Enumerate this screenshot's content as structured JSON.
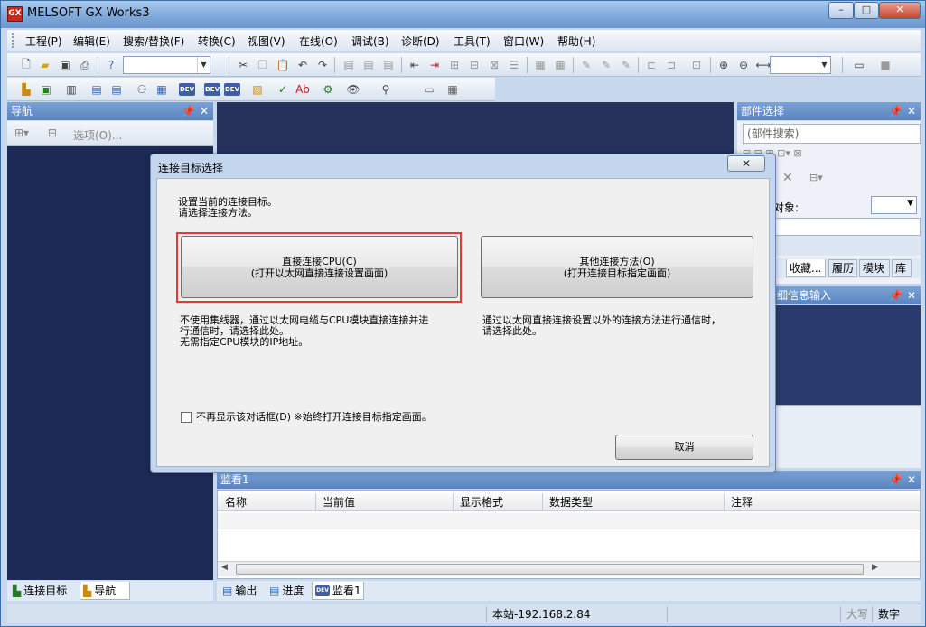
{
  "window": {
    "title": "MELSOFT GX Works3",
    "controls": [
      "–",
      "□",
      "✕"
    ]
  },
  "menu": [
    "工程(P)",
    "编辑(E)",
    "搜索/替换(F)",
    "转换(C)",
    "视图(V)",
    "在线(O)",
    "调试(B)",
    "诊断(D)",
    "工具(T)",
    "窗口(W)",
    "帮助(H)"
  ],
  "nav_pane": {
    "title": "导航",
    "options_label": "选项(O)...",
    "tabs": [
      "连接目标",
      "导航"
    ]
  },
  "parts_pane": {
    "title": "部件选择",
    "search_placeholder": "(部件搜索)",
    "object_label": "对象:",
    "tabs": [
      "收藏...",
      "履历",
      "模块",
      "库"
    ]
  },
  "detail_pane": {
    "title": "细信息输入"
  },
  "dialog": {
    "title": "连接目标选择",
    "close": "✕",
    "intro_line1": "设置当前的连接目标。",
    "intro_line2": "请选择连接方法。",
    "direct_button_line1": "直接连接CPU(C)",
    "direct_button_line2": "(打开以太网直接连接设置画面)",
    "other_button_line1": "其他连接方法(O)",
    "other_button_line2": "(打开连接目标指定画面)",
    "direct_desc": "不使用集线器，通过以太网电缆与CPU模块直接连接并进\n行通信时，请选择此处。\n无需指定CPU模块的IP地址。",
    "other_desc": "通过以太网直接连接设置以外的连接方法进行通信时，\n请选择此处。",
    "checkbox_label": "不再显示该对话框(D) ※始终打开连接目标指定画面。",
    "checkbox_checked": false,
    "cancel_label": "取消"
  },
  "watch": {
    "title": "监看1",
    "columns": [
      "名称",
      "当前值",
      "显示格式",
      "数据类型",
      "注释"
    ],
    "rows": []
  },
  "bottom_tabs": [
    "输出",
    "进度",
    "监看1"
  ],
  "status_bar": {
    "station": "本站-192.168.2.84",
    "caps": "大写",
    "num": "数字"
  },
  "colors": {
    "title_bar": "#7ca7d9",
    "pane_title": "#5a84c0",
    "workspace": "#1d2a55",
    "highlight": "#e53935"
  }
}
